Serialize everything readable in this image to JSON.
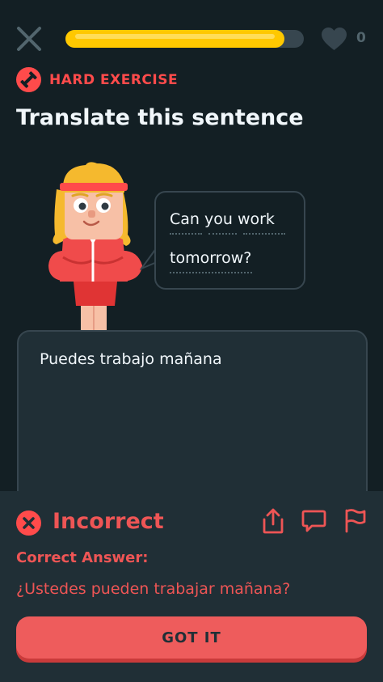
{
  "header": {
    "close_icon": "close-icon",
    "progress": 0.92,
    "progress_color": "#ffc800",
    "heart_icon": "heart-icon",
    "hearts_count": "0"
  },
  "exercise": {
    "badge_icon": "dumbbell-icon",
    "badge_label": "HARD EXERCISE",
    "accent_color": "#ff4b4b",
    "title": "Translate this sentence"
  },
  "prompt": {
    "line1": "Can you work",
    "line2": "tomorrow?"
  },
  "answer": {
    "text": "Puedes trabajo mañana"
  },
  "feedback": {
    "status_icon": "x-icon",
    "status": "Incorrect",
    "correct_label": "Correct Answer:",
    "correct_value": "¿Ustedes pueden trabajar mañana?",
    "button_label": "GOT IT",
    "actions": [
      "share-icon",
      "comment-icon",
      "flag-icon"
    ],
    "color": "#ee5555"
  }
}
